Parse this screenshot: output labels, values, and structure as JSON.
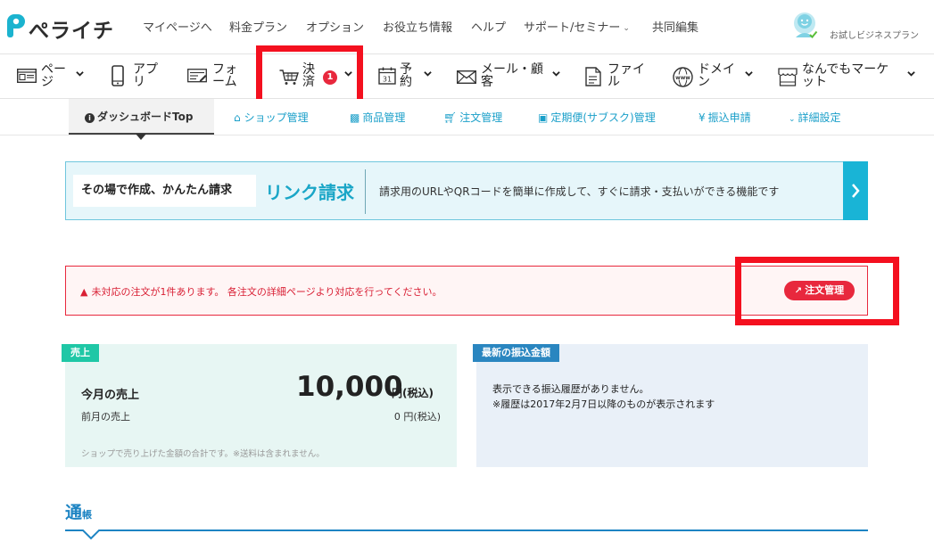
{
  "brand": {
    "name": "ぺライチ",
    "accent": "#1aa6c7",
    "logo_color": "#1bb3cf"
  },
  "header": {
    "nav": [
      {
        "label": "マイページへ",
        "dropdown": false
      },
      {
        "label": "料金プラン",
        "dropdown": false
      },
      {
        "label": "オプション",
        "dropdown": false
      },
      {
        "label": "お役立ち情報",
        "dropdown": false
      },
      {
        "label": "ヘルプ",
        "dropdown": false
      },
      {
        "label": "サポート/セミナー",
        "dropdown": true
      },
      {
        "label": "共同編集",
        "dropdown": false
      }
    ],
    "plan_label": "お試しビジネスプラン"
  },
  "main_nav": {
    "items": [
      {
        "label": "ページ",
        "icon": "page-icon"
      },
      {
        "label": "アプリ",
        "icon": "smartphone-icon"
      },
      {
        "label": "フォーム",
        "icon": "form-icon"
      },
      {
        "label": "決済",
        "icon": "cart-icon",
        "badge": "1"
      },
      {
        "label": "予約",
        "icon": "calendar-icon",
        "icon_text": "31"
      },
      {
        "label": "メール・顧客",
        "icon": "mail-icon"
      },
      {
        "label": "ファイル",
        "icon": "file-icon"
      },
      {
        "label": "ドメイン",
        "icon": "globe-icon",
        "icon_text": "www"
      },
      {
        "label": "なんでもマーケット",
        "icon": "shop-icon"
      }
    ]
  },
  "sub_nav": {
    "active": "ダッシュボードTop",
    "items": [
      {
        "label": "ショップ管理",
        "icon": "home-icon"
      },
      {
        "label": "商品管理",
        "icon": "boxes-icon"
      },
      {
        "label": "注文管理",
        "icon": "cart-icon"
      },
      {
        "label": "定期便(サブスク)管理",
        "icon": "truck-icon"
      },
      {
        "label": "振込申請",
        "icon": "yen-icon",
        "icon_text": "¥"
      },
      {
        "label": "詳細設定",
        "icon": "chevron-down-icon"
      }
    ]
  },
  "link_banner": {
    "lead": "その場で作成、かんたん請求",
    "title": "リンク請求",
    "description": "請求用のURLやQRコードを簡単に作成して、すぐに請求・支払いができる機能です"
  },
  "alert": {
    "message": "未対応の注文が1件あります。 各注文の詳細ページより対応を行ってください。",
    "button": "注文管理",
    "color": "#e8283d"
  },
  "sales": {
    "tag": "売上",
    "tag_color": "#1fc7a6",
    "this_month_label": "今月の売上",
    "this_month_value": "10,000",
    "this_month_unit": "円(税込)",
    "last_month_label": "前月の売上",
    "last_month_value": "0 円(税込)",
    "note": "ショップで売り上げた金額の合計です。※送料は含まれません。"
  },
  "transfer": {
    "tag": "最新の振込金額",
    "tag_color": "#2a86c0",
    "line1": "表示できる振込履歴がありません。",
    "line2": "※履歴は2017年2月7日以降のものが表示されます"
  },
  "passbook": {
    "title_big": "通",
    "title_small": "帳"
  }
}
